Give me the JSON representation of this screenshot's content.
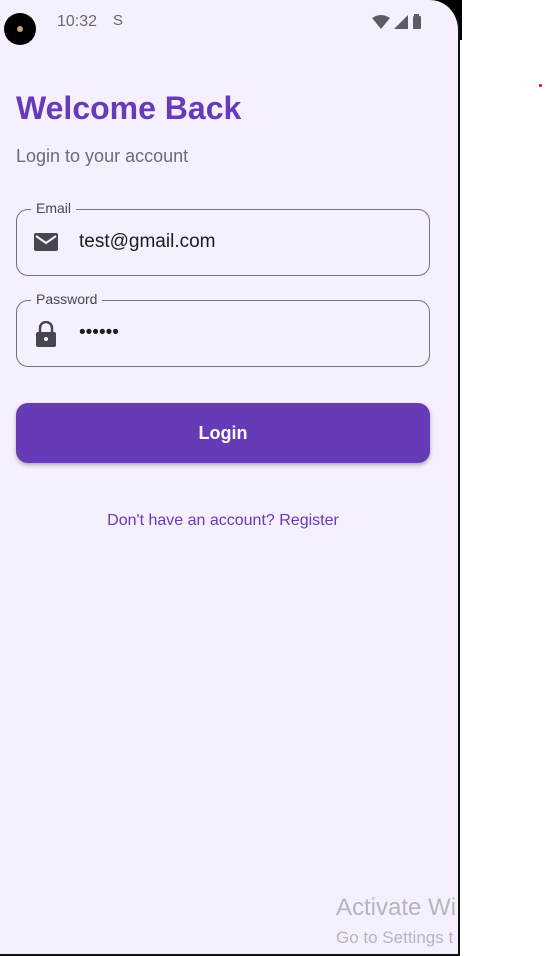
{
  "status": {
    "time": "10:32",
    "sim_icon": "S"
  },
  "header": {
    "title": "Welcome Back",
    "subtitle": "Login to your account"
  },
  "form": {
    "email_label": "Email",
    "email_value": "test@gmail.com",
    "password_label": "Password",
    "password_value": "••••••",
    "login_label": "Login"
  },
  "register_link": "Don't have an account? Register",
  "watermark": {
    "line1": "Activate Wi",
    "line2": "Go to Settings t"
  },
  "colors": {
    "accent": "#673ab7",
    "background": "#f6effd"
  }
}
